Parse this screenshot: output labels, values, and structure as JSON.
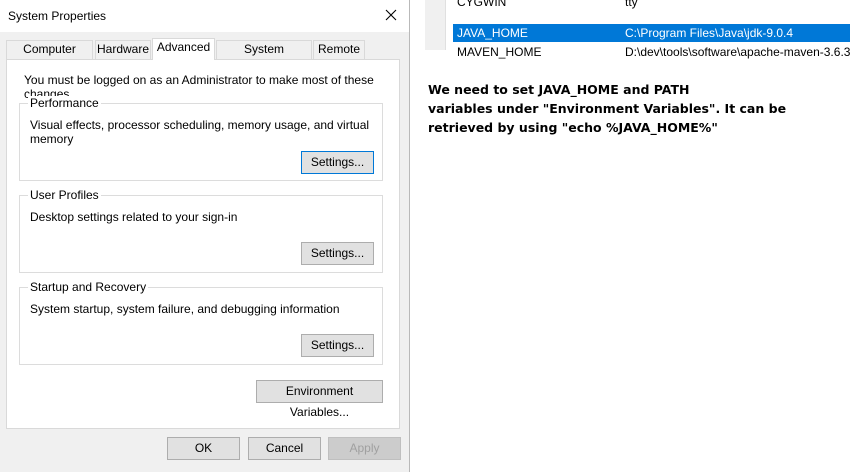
{
  "window": {
    "title": "System Properties",
    "close_glyph": "✕"
  },
  "tabs": [
    {
      "label": "Computer Name",
      "active": false
    },
    {
      "label": "Hardware",
      "active": false
    },
    {
      "label": "Advanced",
      "active": true
    },
    {
      "label": "System Protection",
      "active": false
    },
    {
      "label": "Remote",
      "active": false
    }
  ],
  "admin_note": "You must be logged on as an Administrator to make most of these changes.",
  "groups": {
    "performance": {
      "label": "Performance",
      "description": "Visual effects, processor scheduling, memory usage, and virtual memory",
      "button": "Settings..."
    },
    "user_profiles": {
      "label": "User Profiles",
      "description": "Desktop settings related to your sign-in",
      "button": "Settings..."
    },
    "startup": {
      "label": "Startup and Recovery",
      "description": "System startup, system failure, and debugging information",
      "button": "Settings..."
    }
  },
  "env_button": "Environment Variables...",
  "footer": {
    "ok": "OK",
    "cancel": "Cancel",
    "apply": "Apply"
  },
  "env_list": {
    "rows": [
      {
        "name": "CYGWIN",
        "value": "tty"
      },
      {
        "name": "JAVA_HOME",
        "value": "C:\\Program Files\\Java\\jdk-9.0.4",
        "selected": true
      },
      {
        "name": "MAVEN_HOME",
        "value": "D:\\dev\\tools\\software\\apache-maven-3.6.3"
      }
    ]
  },
  "annotation": [
    "We need to set JAVA_HOME and PATH",
    "variables under \"Environment Variables\". It can be",
    "retrieved by using \"echo %JAVA_HOME%\""
  ],
  "colors": {
    "selection": "#0078d7",
    "dialog_bg": "#f0f0f0",
    "button_bg": "#e1e1e1",
    "focus_border": "#0078d7"
  }
}
